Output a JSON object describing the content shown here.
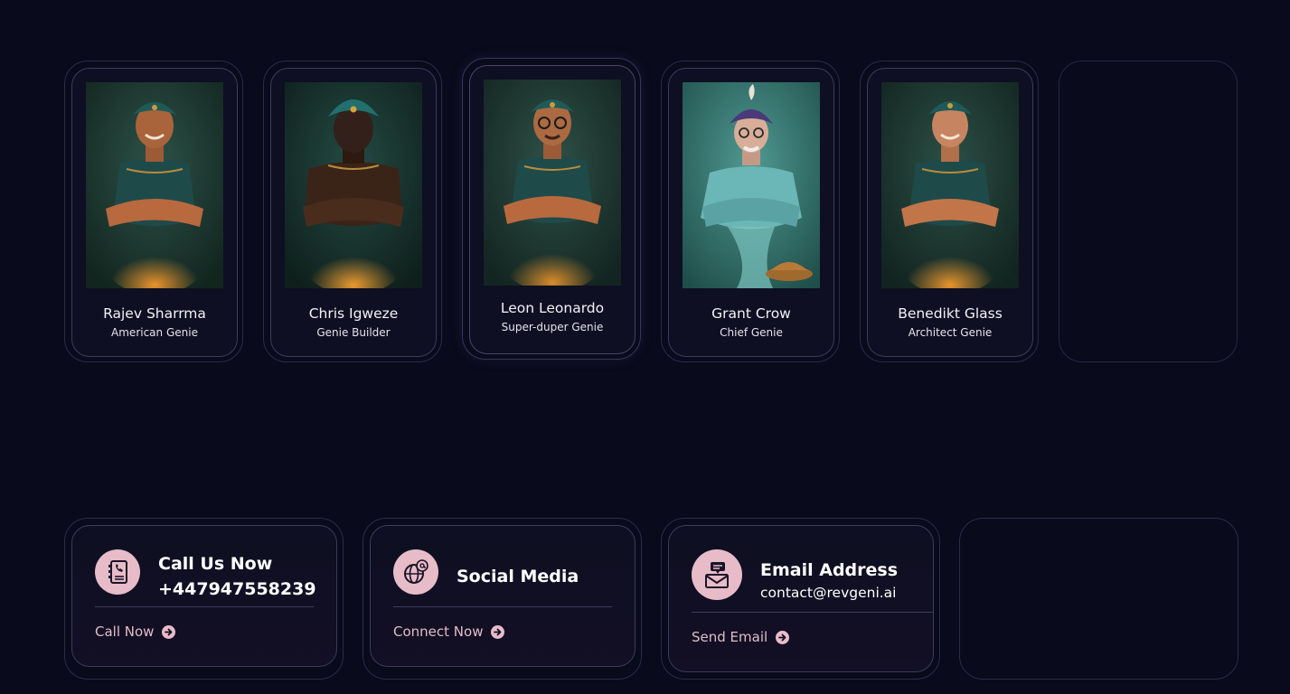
{
  "team": [
    {
      "name": "Rajev Sharrma",
      "role": "American Genie",
      "palette": "warm-teal",
      "image": "genie-portrait-smiling"
    },
    {
      "name": "Chris Igweze",
      "role": "Genie Builder",
      "palette": "dark-teal",
      "image": "genie-portrait-muscular"
    },
    {
      "name": "Leon Leonardo",
      "role": "Super-duper Genie",
      "palette": "warm-teal",
      "image": "genie-portrait-glasses"
    },
    {
      "name": "Grant Crow",
      "role": "Chief Genie",
      "palette": "blue-genie",
      "image": "genie-portrait-lamp"
    },
    {
      "name": "Benedikt Glass",
      "role": "Architect Genie",
      "palette": "warm-teal",
      "image": "genie-portrait-young"
    }
  ],
  "contacts": [
    {
      "title": "Call Us Now",
      "value": "+447947558239",
      "action": "Call Now",
      "icon": "phone-book-icon"
    },
    {
      "title": "Social Media",
      "value": "",
      "action": "Connect Now",
      "icon": "globe-at-icon"
    },
    {
      "title": "Email Address",
      "value": "contact@revgeni.ai",
      "action": "Send Email",
      "icon": "envelope-chat-icon"
    }
  ],
  "colors": {
    "background": "#090a1b",
    "card_border": "#2b2d48",
    "icon_badge": "#e7bcc8",
    "action_text": "#e1bcc8"
  }
}
